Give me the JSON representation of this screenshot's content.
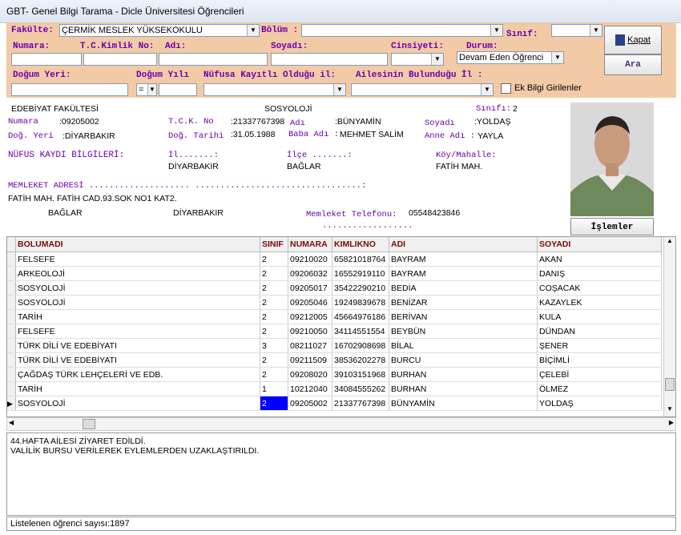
{
  "window": {
    "title": "GBT- Genel Bilgi Tarama - Dicle Üniversitesi Öğrencileri"
  },
  "filter": {
    "fakulte_label": "Fakülte:",
    "fakulte_value": "ÇERMİK MESLEK YÜKSEKOKULU",
    "bolum_label": "Bölüm :",
    "sinif_label": "Sınıf:",
    "numara_label": "Numara:",
    "tc_label": "T.C.Kimlik No:",
    "adi_label": "Adı:",
    "soyadi_label": "Soyadı:",
    "cinsiyet_label": "Cinsiyeti:",
    "durum_label": "Durum:",
    "durum_value": "Devam Eden Öğrenci",
    "dogum_yeri_label": "Doğum Yeri:",
    "dogum_yili_label": "Doğum Yılı",
    "yil_op": "=",
    "nufus_label": "Nüfusa Kayıtlı Olduğu il:",
    "aile_label": "Ailesinin Bulunduğu İl :",
    "ek_bilgi_label": "Ek Bilgi Girilenler",
    "kapat_label": "Kapat",
    "ara_label": "Ara"
  },
  "detail": {
    "fakulte": "EDEBİYAT FAKÜLTESİ",
    "bolum": "SOSYOLOJİ",
    "sinif_label": "Sınıfı:",
    "sinif": "2",
    "numara_label": "Numara",
    "numara": ":09205002",
    "tck_label": "T.C.K. No",
    "tck": ":21337767398",
    "adi_label": "Adı",
    "adi": ":BÜNYAMİN",
    "soyadi_label": "Soyadı",
    "soyadi": ":YOLDAŞ",
    "dog_yeri_label": "Doğ. Yeri",
    "dog_yeri": ":DİYARBAKIR",
    "dog_tarihi_label": "Doğ. Tarihi",
    "dog_tarihi": ":31.05.1988",
    "baba_label": "Baba Adı :",
    "baba": "MEHMET SALİM",
    "anne_label": "Anne Adı :",
    "anne": "YAYLA",
    "nufus_header": "NÜFUS KAYDI BİLGİLERİ:",
    "il_label": "İl.......:",
    "il": "DİYARBAKIR",
    "ilce_label": "İlçe .......:",
    "ilce": "BAĞLAR",
    "koy_label": "Köy/Mahalle:",
    "koy": "FATİH MAH.",
    "memleket_label": "MEMLEKET ADRESİ .................... .................................:",
    "adres": "FATİH MAH. FATİH CAD.93.SOK NO1 KAT2.",
    "adres_ilce": "BAĞLAR",
    "adres_il": "DİYARBAKIR",
    "tel_label": "Memleket Telefonu:",
    "tel": "05548423846",
    "dots": "..................",
    "islemler_label": "İşlemler"
  },
  "table": {
    "headers": [
      "BOLUMADI",
      "SINIF",
      "NUMARA",
      "KIMLIKNO",
      "ADI",
      "SOYADI"
    ],
    "rows": [
      [
        "FELSEFE",
        "2",
        "09210020",
        "65821018764",
        "BAYRAM",
        "AKAN"
      ],
      [
        "ARKEOLOJİ",
        "2",
        "09206032",
        "16552919110",
        "BAYRAM",
        "DANIŞ"
      ],
      [
        "SOSYOLOJİ",
        "2",
        "09205017",
        "35422290210",
        "BEDİA",
        "COŞACAK"
      ],
      [
        "SOSYOLOJİ",
        "2",
        "09205046",
        "19249839678",
        "BENİZAR",
        "KAZAYLEK"
      ],
      [
        "TARİH",
        "2",
        "09212005",
        "45664976186",
        "BERİVAN",
        "KULA"
      ],
      [
        "FELSEFE",
        "2",
        "09210050",
        "34114551554",
        "BEYBÜN",
        "DÜNDAN"
      ],
      [
        "TÜRK DİLİ VE EDEBİYATI",
        "3",
        "08211027",
        "16702908698",
        "BİLAL",
        "ŞENER"
      ],
      [
        "TÜRK DİLİ VE EDEBİYATI",
        "2",
        "09211509",
        "38536202278",
        "BURCU",
        "BİÇİMLİ"
      ],
      [
        "ÇAĞDAŞ TÜRK LEHÇELERİ VE EDB.",
        "2",
        "09208020",
        "39103151968",
        "BURHAN",
        "ÇELEBİ"
      ],
      [
        "TARİH",
        "1",
        "10212040",
        "34084555262",
        "BURHAN",
        "ÖLMEZ"
      ],
      [
        "SOSYOLOJİ",
        "2",
        "09205002",
        "21337767398",
        "BÜNYAMİN",
        "YOLDAŞ"
      ]
    ]
  },
  "notes": {
    "line1": "44.HAFTA AİLESİ ZİYARET EDİLDİ.",
    "line2": "VALİLİK BURSU VERİLEREK EYLEMLERDEN UZAKLAŞTIRILDI."
  },
  "status": {
    "text": "Listelenen öğrenci sayısı:1897"
  },
  "colors": {
    "filter_bg": "#f3caa6",
    "label": "#6a00b0",
    "header_text": "#7a0a0a",
    "selected": "#0000ff"
  }
}
